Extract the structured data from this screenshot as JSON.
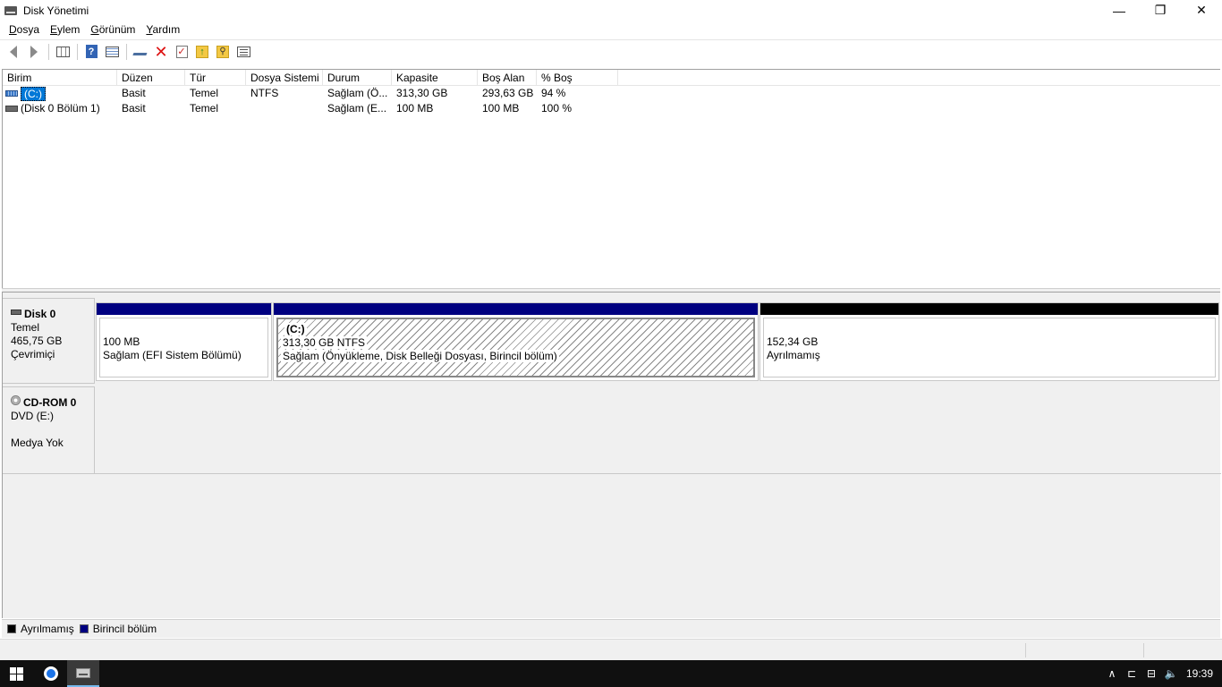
{
  "window": {
    "title": "Disk Yönetimi",
    "controls": {
      "minimize": "—",
      "restore": "❐",
      "close": "✕"
    }
  },
  "menu": [
    {
      "acc": "D",
      "rest": "osya"
    },
    {
      "acc": "E",
      "rest": "ylem"
    },
    {
      "acc": "G",
      "rest": "örünüm"
    },
    {
      "acc": "Y",
      "rest": "ardım"
    }
  ],
  "toolbar": {
    "icons": [
      "back-arrow-icon",
      "forward-arrow-icon",
      "console-tree-icon",
      "help-icon",
      "list-view-icon",
      "connect-drive-icon",
      "delete-icon",
      "properties-check-icon",
      "folder-up-icon",
      "search-icon",
      "properties-icon"
    ],
    "check_glyph": "✓",
    "folder_up_glyph": "↑",
    "search_glyph": "⚲",
    "delete_glyph": "✕",
    "help_glyph": "?"
  },
  "volume_list": {
    "headers": [
      "Birim",
      "Düzen",
      "Tür",
      "Dosya Sistemi",
      "Durum",
      "Kapasite",
      "Boş Alan",
      "% Boş"
    ],
    "rows": [
      {
        "birim": "(C:)",
        "duzen": "Basit",
        "tur": "Temel",
        "dosya_sistemi": "NTFS",
        "durum": "Sağlam (Ö...",
        "kapasite": "313,30 GB",
        "bos_alan": "293,63 GB",
        "yuzde_bos": "94 %",
        "selected": true
      },
      {
        "birim": "(Disk 0 Bölüm 1)",
        "duzen": "Basit",
        "tur": "Temel",
        "dosya_sistemi": "",
        "durum": "Sağlam (E...",
        "kapasite": "100 MB",
        "bos_alan": "100 MB",
        "yuzde_bos": "100 %",
        "selected": false
      }
    ]
  },
  "disks": [
    {
      "name": "Disk 0",
      "type": "Temel",
      "size": "465,75 GB",
      "status": "Çevrimiçi",
      "partitions": [
        {
          "line1": "100 MB",
          "line2": "Sağlam (EFI Sistem Bölümü)",
          "color": "#000080"
        },
        {
          "title": "(C:)",
          "line1": "313,30 GB NTFS",
          "line2": "Sağlam (Önyükleme, Disk Belleği Dosyası, Birincil bölüm)",
          "color": "#000080"
        },
        {
          "line1": "152,34 GB",
          "line2": "Ayrılmamış",
          "color": "#000000"
        }
      ]
    },
    {
      "name": "CD-ROM 0",
      "type": "DVD (E:)",
      "status": "Medya Yok"
    }
  ],
  "legend": [
    {
      "label": "Ayrılmamış",
      "color": "#000000"
    },
    {
      "label": "Birincil bölüm",
      "color": "#000080"
    }
  ],
  "taskbar": {
    "tray_icons": [
      "chevron-up-icon",
      "device-icon",
      "network-icon",
      "volume-icon"
    ],
    "tray_glyphs": [
      "∧",
      "⊏",
      "⊟",
      "🔈"
    ],
    "time": "19:39"
  }
}
